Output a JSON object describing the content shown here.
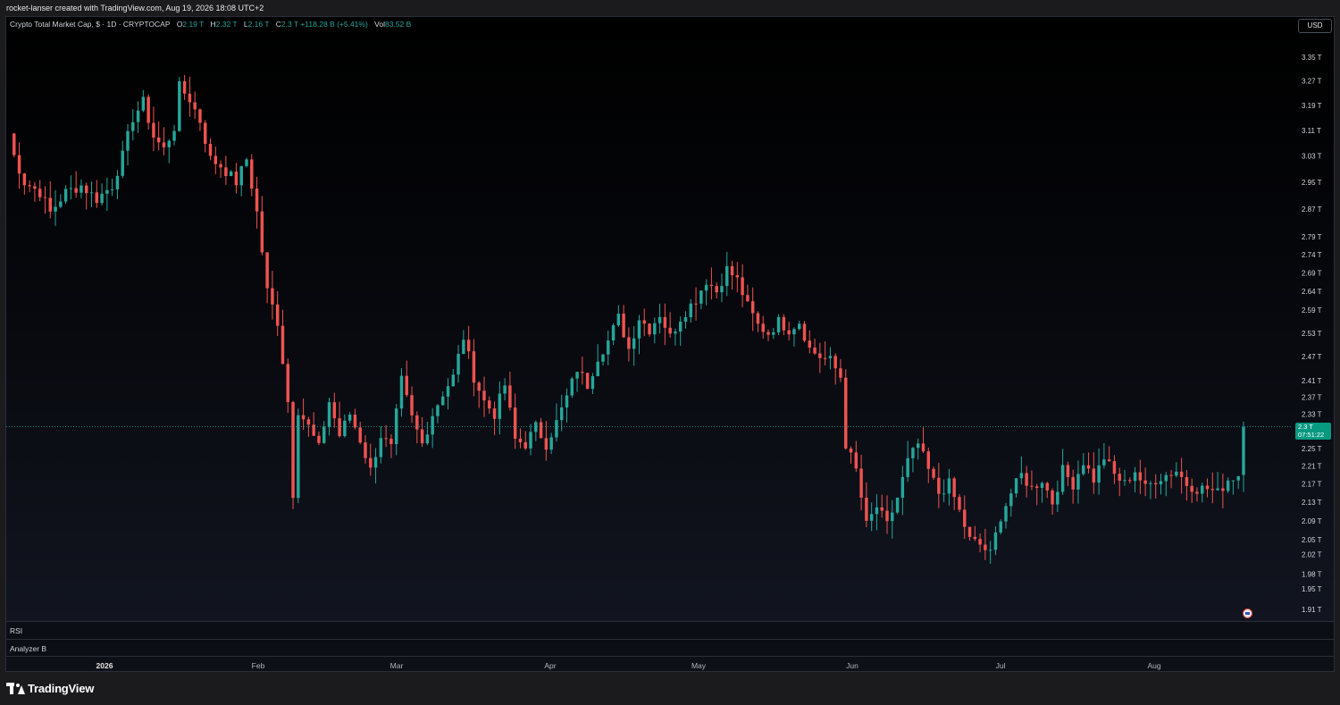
{
  "header": {
    "credit": "rocket-lanser created with TradingView.com, Aug 19, 2026 18:08 UTC+2"
  },
  "legend": {
    "title": "Crypto Total Market Cap, $ · 1D · CRYPTOCAP",
    "o_key": "O",
    "o_val": "2.19 T",
    "h_key": "H",
    "h_val": "2.32 T",
    "l_key": "L",
    "l_val": "2.16 T",
    "c_key": "C",
    "c_val": "2.3 T",
    "change": "+118.28 B (+5.41%)",
    "vol_key": "Vol",
    "vol_val": "83.52 B"
  },
  "toolbar": {
    "currency": "USD"
  },
  "price_axis": {
    "labels": [
      "3.35 T",
      "3.27 T",
      "3.19 T",
      "3.11 T",
      "3.03 T",
      "2.95 T",
      "2.87 T",
      "2.79 T",
      "2.74 T",
      "2.69 T",
      "2.64 T",
      "2.59 T",
      "2.53 T",
      "2.47 T",
      "2.41 T",
      "2.37 T",
      "2.33 T",
      "2.25 T",
      "2.21 T",
      "2.17 T",
      "2.13 T",
      "2.09 T",
      "2.05 T",
      "2.02 T",
      "1.98 T",
      "1.95 T",
      "1.91 T"
    ],
    "last_price": "2.3 T",
    "countdown": "07:51:22"
  },
  "panes": {
    "rsi": "RSI",
    "analyzer": "Analyzer B"
  },
  "time_axis": {
    "labels": [
      "2026",
      "Feb",
      "Mar",
      "Apr",
      "May",
      "Jun",
      "Jul",
      "Aug"
    ]
  },
  "footer": {
    "brand": "TradingView"
  },
  "colors": {
    "up": "#26a69a",
    "down": "#ef5350",
    "last_price_bg": "#089981",
    "background": "#000000"
  },
  "chart_data": {
    "type": "candlestick",
    "title": "Crypto Total Market Cap, $ · 1D · CRYPTOCAP",
    "unit": "T USD",
    "ylim": [
      1.89,
      3.39
    ],
    "x_range": [
      "2025-12-23",
      "2026-08-19"
    ],
    "anchors": [
      [
        "2025-12-23",
        3.1
      ],
      [
        "2025-12-24",
        3.03
      ],
      [
        "2025-12-26",
        2.95
      ],
      [
        "2025-12-29",
        2.92
      ],
      [
        "2025-12-31",
        2.86
      ],
      [
        "2026-01-03",
        2.92
      ],
      [
        "2026-01-06",
        2.94
      ],
      [
        "2026-01-09",
        2.9
      ],
      [
        "2026-01-12",
        2.94
      ],
      [
        "2026-01-14",
        3.03
      ],
      [
        "2026-01-16",
        3.15
      ],
      [
        "2026-01-18",
        3.2
      ],
      [
        "2026-01-20",
        3.09
      ],
      [
        "2026-01-22",
        3.05
      ],
      [
        "2026-01-24",
        3.12
      ],
      [
        "2026-01-25",
        3.25
      ],
      [
        "2026-01-27",
        3.21
      ],
      [
        "2026-01-29",
        3.14
      ],
      [
        "2026-01-31",
        3.02
      ],
      [
        "2026-02-02",
        3.0
      ],
      [
        "2026-02-05",
        2.95
      ],
      [
        "2026-02-07",
        3.02
      ],
      [
        "2026-02-09",
        2.86
      ],
      [
        "2026-02-11",
        2.64
      ],
      [
        "2026-02-13",
        2.56
      ],
      [
        "2026-02-15",
        2.36
      ],
      [
        "2026-02-16",
        2.15
      ],
      [
        "2026-02-17",
        2.34
      ],
      [
        "2026-02-19",
        2.3
      ],
      [
        "2026-02-21",
        2.25
      ],
      [
        "2026-02-23",
        2.36
      ],
      [
        "2026-02-25",
        2.28
      ],
      [
        "2026-02-27",
        2.33
      ],
      [
        "2026-03-01",
        2.27
      ],
      [
        "2026-03-03",
        2.2
      ],
      [
        "2026-03-05",
        2.28
      ],
      [
        "2026-03-07",
        2.25
      ],
      [
        "2026-03-09",
        2.41
      ],
      [
        "2026-03-11",
        2.32
      ],
      [
        "2026-03-13",
        2.26
      ],
      [
        "2026-03-15",
        2.33
      ],
      [
        "2026-03-17",
        2.38
      ],
      [
        "2026-03-19",
        2.42
      ],
      [
        "2026-03-21",
        2.52
      ],
      [
        "2026-03-23",
        2.42
      ],
      [
        "2026-03-25",
        2.36
      ],
      [
        "2026-03-27",
        2.33
      ],
      [
        "2026-03-29",
        2.4
      ],
      [
        "2026-03-31",
        2.27
      ],
      [
        "2026-04-02",
        2.26
      ],
      [
        "2026-04-04",
        2.3
      ],
      [
        "2026-04-06",
        2.26
      ],
      [
        "2026-04-08",
        2.31
      ],
      [
        "2026-04-10",
        2.37
      ],
      [
        "2026-04-12",
        2.44
      ],
      [
        "2026-04-14",
        2.4
      ],
      [
        "2026-04-16",
        2.47
      ],
      [
        "2026-04-18",
        2.51
      ],
      [
        "2026-04-20",
        2.57
      ],
      [
        "2026-04-22",
        2.49
      ],
      [
        "2026-04-24",
        2.57
      ],
      [
        "2026-04-26",
        2.54
      ],
      [
        "2026-04-28",
        2.58
      ],
      [
        "2026-04-30",
        2.52
      ],
      [
        "2026-05-02",
        2.57
      ],
      [
        "2026-05-05",
        2.62
      ],
      [
        "2026-05-07",
        2.67
      ],
      [
        "2026-05-09",
        2.64
      ],
      [
        "2026-05-11",
        2.7
      ],
      [
        "2026-05-13",
        2.67
      ],
      [
        "2026-05-15",
        2.6
      ],
      [
        "2026-05-17",
        2.55
      ],
      [
        "2026-05-19",
        2.53
      ],
      [
        "2026-05-21",
        2.56
      ],
      [
        "2026-05-23",
        2.54
      ],
      [
        "2026-05-25",
        2.56
      ],
      [
        "2026-05-27",
        2.49
      ],
      [
        "2026-05-29",
        2.47
      ],
      [
        "2026-05-31",
        2.46
      ],
      [
        "2026-06-02",
        2.42
      ],
      [
        "2026-06-03",
        2.26
      ],
      [
        "2026-06-05",
        2.2
      ],
      [
        "2026-06-07",
        2.08
      ],
      [
        "2026-06-09",
        2.12
      ],
      [
        "2026-06-11",
        2.08
      ],
      [
        "2026-06-13",
        2.14
      ],
      [
        "2026-06-15",
        2.22
      ],
      [
        "2026-06-17",
        2.26
      ],
      [
        "2026-06-19",
        2.2
      ],
      [
        "2026-06-21",
        2.15
      ],
      [
        "2026-06-23",
        2.17
      ],
      [
        "2026-06-25",
        2.11
      ],
      [
        "2026-06-27",
        2.05
      ],
      [
        "2026-06-29",
        2.04
      ],
      [
        "2026-07-01",
        2.02
      ],
      [
        "2026-07-03",
        2.1
      ],
      [
        "2026-07-05",
        2.15
      ],
      [
        "2026-07-07",
        2.19
      ],
      [
        "2026-07-09",
        2.16
      ],
      [
        "2026-07-11",
        2.18
      ],
      [
        "2026-07-13",
        2.13
      ],
      [
        "2026-07-15",
        2.2
      ],
      [
        "2026-07-17",
        2.17
      ],
      [
        "2026-07-19",
        2.22
      ],
      [
        "2026-07-21",
        2.18
      ],
      [
        "2026-07-23",
        2.23
      ],
      [
        "2026-07-25",
        2.19
      ],
      [
        "2026-07-27",
        2.17
      ],
      [
        "2026-07-29",
        2.2
      ],
      [
        "2026-07-31",
        2.16
      ],
      [
        "2026-08-02",
        2.18
      ],
      [
        "2026-08-04",
        2.19
      ],
      [
        "2026-08-06",
        2.2
      ],
      [
        "2026-08-08",
        2.17
      ],
      [
        "2026-08-10",
        2.16
      ],
      [
        "2026-08-12",
        2.16
      ],
      [
        "2026-08-14",
        2.15
      ],
      [
        "2026-08-16",
        2.18
      ],
      [
        "2026-08-18",
        2.19
      ],
      [
        "2026-08-19",
        2.3
      ]
    ]
  }
}
